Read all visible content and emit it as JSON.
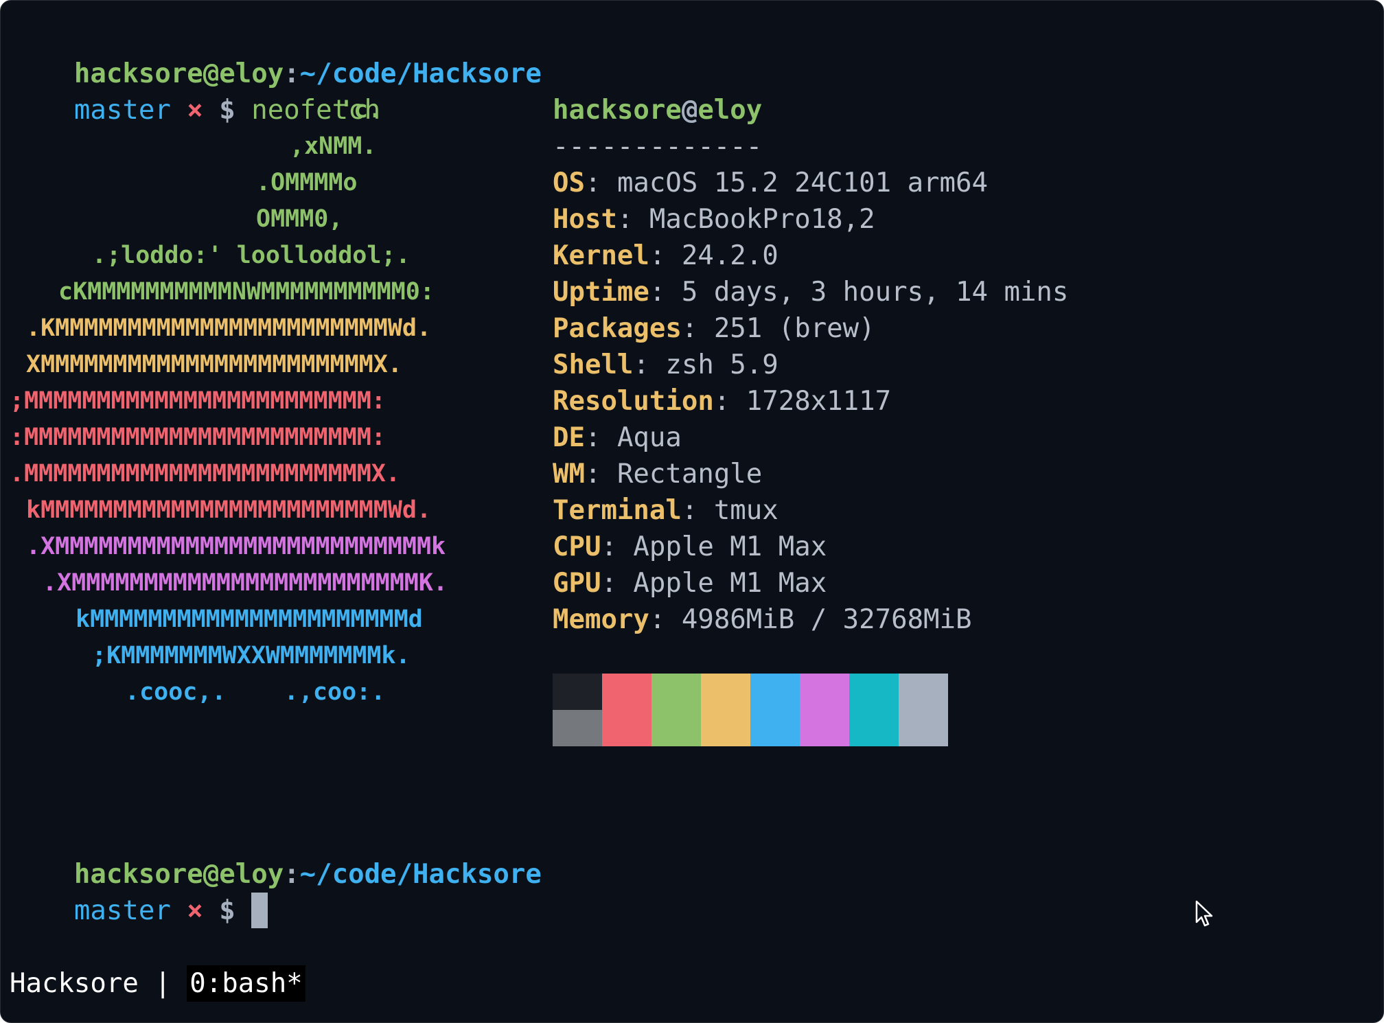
{
  "prompt": {
    "user": "hacksore",
    "at": "@",
    "host": "eloy",
    "colon": ":",
    "path": "~/code/Hacksore",
    "branch": "master",
    "dirty_mark": "×",
    "dollar": "$",
    "command": "neofetch"
  },
  "ascii_art": [
    "'c.",
    ",xNMM.",
    ".OMMMMo",
    "OMMM0,",
    ".;loddo:' loolloddol;.",
    "cKMMMMMMMMMMNWMMMMMMMMMM0:",
    ".KMMMMMMMMMMMMMMMMMMMMMMMWd.",
    "XMMMMMMMMMMMMMMMMMMMMMMMX.",
    ";MMMMMMMMMMMMMMMMMMMMMMMM:",
    ":MMMMMMMMMMMMMMMMMMMMMMMM:",
    ".MMMMMMMMMMMMMMMMMMMMMMMMX.",
    "kMMMMMMMMMMMMMMMMMMMMMMMMWd.",
    ".XMMMMMMMMMMMMMMMMMMMMMMMMMMk",
    ".XMMMMMMMMMMMMMMMMMMMMMMMMK.",
    "kMMMMMMMMMMMMMMMMMMMMMMd",
    ";KMMMMMMMWXXWMMMMMMMk.",
    ".cooc,.    .,coo:."
  ],
  "info": {
    "title_user": "hacksore",
    "title_at": "@",
    "title_host": "eloy",
    "separator": "-------------",
    "fields": [
      {
        "key": "OS",
        "value": "macOS 15.2 24C101 arm64"
      },
      {
        "key": "Host",
        "value": "MacBookPro18,2"
      },
      {
        "key": "Kernel",
        "value": "24.2.0"
      },
      {
        "key": "Uptime",
        "value": "5 days, 3 hours, 14 mins"
      },
      {
        "key": "Packages",
        "value": "251 (brew)"
      },
      {
        "key": "Shell",
        "value": "zsh 5.9"
      },
      {
        "key": "Resolution",
        "value": "1728x1117"
      },
      {
        "key": "DE",
        "value": "Aqua"
      },
      {
        "key": "WM",
        "value": "Rectangle"
      },
      {
        "key": "Terminal",
        "value": "tmux"
      },
      {
        "key": "CPU",
        "value": "Apple M1 Max"
      },
      {
        "key": "GPU",
        "value": "Apple M1 Max"
      },
      {
        "key": "Memory",
        "value": "4986MiB / 32768MiB"
      }
    ],
    "key_separator": ": "
  },
  "palette": {
    "top": [
      "#1e2228",
      "#f06470",
      "#8dc26b",
      "#ecbf6a",
      "#3fb0f0",
      "#d474e0",
      "#16b8c5",
      "#a6b0bf"
    ],
    "bottom": [
      "#75787d",
      "#f06470",
      "#8dc26b",
      "#ecbf6a",
      "#3fb0f0",
      "#d474e0",
      "#16b8c5",
      "#a6b0bf"
    ]
  },
  "tmux": {
    "session": "Hacksore",
    "divider": " | ",
    "window": "0:bash*"
  },
  "colors": {
    "background": "#0b1018",
    "green": "#8dc26b",
    "blue": "#3fb0f0",
    "red": "#f06470",
    "yellow": "#ecbf6a",
    "magenta": "#d474e0",
    "text": "#b8bfca"
  },
  "icons": {
    "mouse": "arrow-cursor-icon"
  }
}
